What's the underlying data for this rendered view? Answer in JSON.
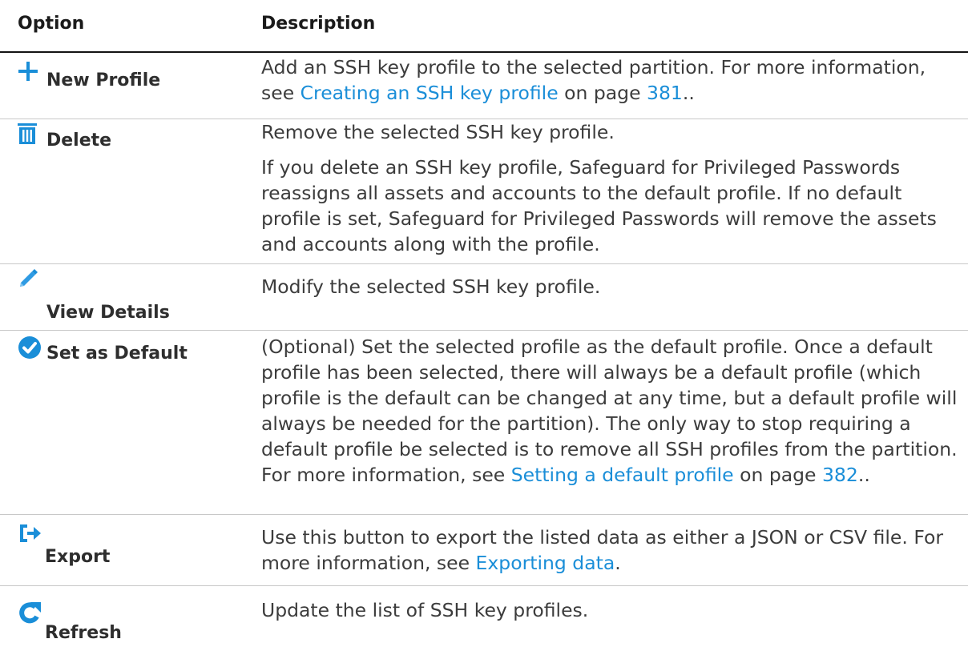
{
  "header": {
    "option": "Option",
    "description": "Description"
  },
  "rows": {
    "new_profile": {
      "label": "New Profile",
      "icon": "plus-icon",
      "p1_pre": "Add an SSH key profile to the selected partition. For more information, see ",
      "p1_link": "Creating an SSH key profile",
      "p1_mid": " on page ",
      "p1_page": "381",
      "p1_post": ".."
    },
    "delete": {
      "label": "Delete",
      "icon": "trash-icon",
      "p1": "Remove the selected SSH key profile.",
      "p2": "If you delete an SSH key profile, Safeguard for Privileged Passwords reassigns all assets and accounts to the default profile. If no default profile is set, Safeguard for Privileged Passwords will remove the assets and accounts along with the profile."
    },
    "view_details": {
      "label": "View Details",
      "icon": "pencil-icon",
      "p1": "Modify the selected SSH key profile."
    },
    "set_default": {
      "label": "Set as Default",
      "icon": "checkmark-circle-icon",
      "p1_pre": "(Optional) Set the selected profile as the default profile. Once a default profile has been selected, there will always be a default profile (which profile is the default can be changed at any time, but a default profile will always be needed for the partition). The only way to stop requiring a default profile be selected is to remove all SSH profiles from the partition. For more information, see ",
      "p1_link": "Setting a default profile",
      "p1_mid": " on page ",
      "p1_page": "382",
      "p1_post": ".."
    },
    "export": {
      "label": "Export",
      "icon": "export-icon",
      "p1_pre": "Use this button to export the listed data as either a JSON or CSV file. For more information, see ",
      "p1_link": "Exporting data",
      "p1_post": "."
    },
    "refresh": {
      "label": "Refresh",
      "icon": "refresh-icon",
      "p1": "Update the list of SSH key profiles."
    }
  },
  "colors": {
    "accent": "#1a8ed8",
    "text": "#3c3c3c",
    "heading": "#1a1a1a",
    "rule": "#141414",
    "divider": "#c8c8c8"
  }
}
